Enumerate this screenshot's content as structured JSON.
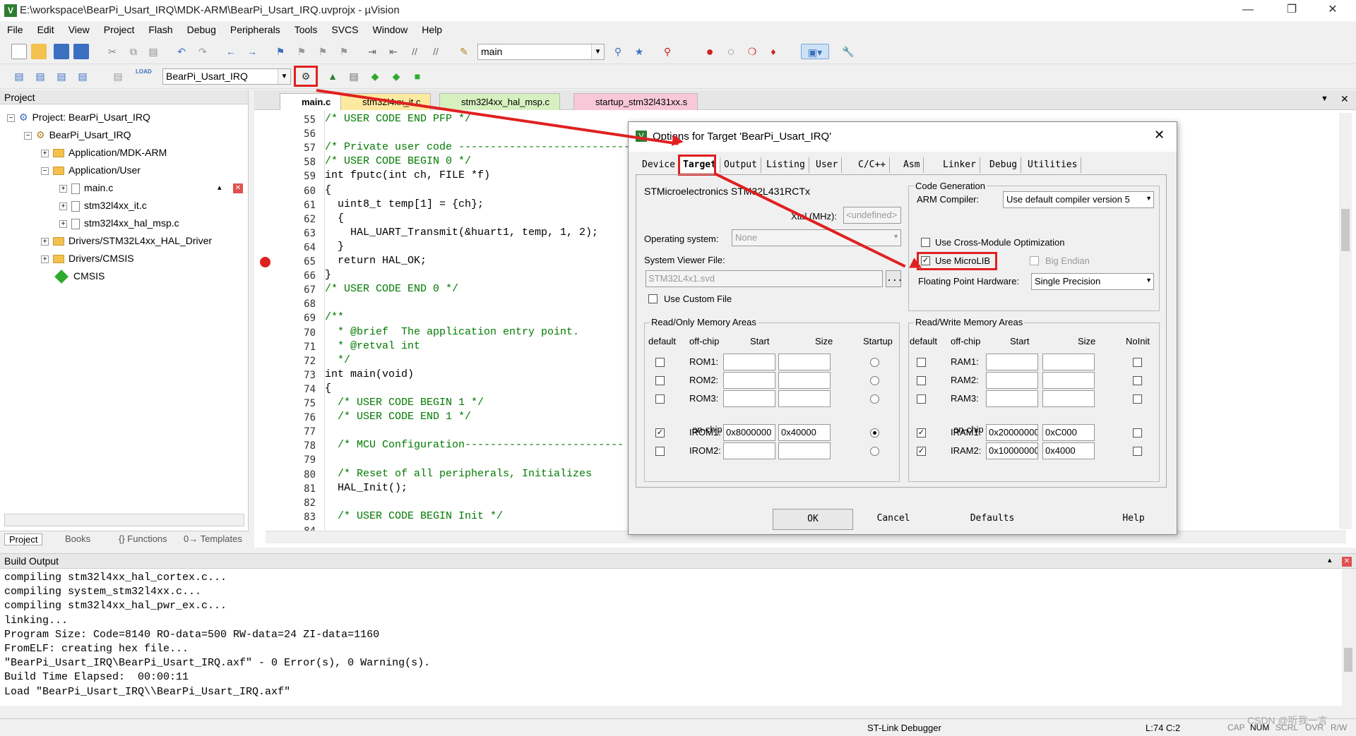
{
  "window": {
    "title": "E:\\workspace\\BearPi_Usart_IRQ\\MDK-ARM\\BearPi_Usart_IRQ.uvprojx - µVision"
  },
  "menu": [
    "File",
    "Edit",
    "View",
    "Project",
    "Flash",
    "Debug",
    "Peripherals",
    "Tools",
    "SVCS",
    "Window",
    "Help"
  ],
  "toolbar": {
    "find_combo": "main",
    "target_combo": "BearPi_Usart_IRQ",
    "load_label": "LOAD"
  },
  "project_panel": {
    "header": "Project",
    "tree": [
      {
        "label": "Project: BearPi_Usart_IRQ"
      },
      {
        "label": "BearPi_Usart_IRQ"
      },
      {
        "label": "Application/MDK-ARM"
      },
      {
        "label": "Application/User"
      },
      {
        "label": "main.c"
      },
      {
        "label": "stm32l4xx_it.c"
      },
      {
        "label": "stm32l4xx_hal_msp.c"
      },
      {
        "label": "Drivers/STM32L4xx_HAL_Driver"
      },
      {
        "label": "Drivers/CMSIS"
      },
      {
        "label": "CMSIS"
      }
    ],
    "tabs": [
      "Project",
      "Books",
      "{} Functions",
      "0→ Templates"
    ]
  },
  "editor": {
    "tabs": [
      "main.c",
      "stm32l4xx_it.c",
      "stm32l4xx_hal_msp.c",
      "startup_stm32l431xx.s"
    ],
    "lines": [
      {
        "n": "55",
        "t": "/* USER CODE END PFP */"
      },
      {
        "n": "56",
        "t": ""
      },
      {
        "n": "57",
        "t": "/* Private user code ---------------------------"
      },
      {
        "n": "58",
        "t": "/* USER CODE BEGIN 0 */"
      },
      {
        "n": "59",
        "t": "int fputc(int ch, FILE *f)"
      },
      {
        "n": "60",
        "t": "{"
      },
      {
        "n": "61",
        "t": "  uint8_t temp[1] = {ch};"
      },
      {
        "n": "62",
        "t": "  {"
      },
      {
        "n": "63",
        "t": "    HAL_UART_Transmit(&huart1, temp, 1, 2);"
      },
      {
        "n": "64",
        "t": "  }"
      },
      {
        "n": "65",
        "t": "  return HAL_OK;"
      },
      {
        "n": "66",
        "t": "}"
      },
      {
        "n": "67",
        "t": "/* USER CODE END 0 */"
      },
      {
        "n": "68",
        "t": ""
      },
      {
        "n": "69",
        "t": "/**"
      },
      {
        "n": "70",
        "t": "  * @brief  The application entry point."
      },
      {
        "n": "71",
        "t": "  * @retval int"
      },
      {
        "n": "72",
        "t": "  */"
      },
      {
        "n": "73",
        "t": "int main(void)"
      },
      {
        "n": "74",
        "t": "{"
      },
      {
        "n": "75",
        "t": "  /* USER CODE BEGIN 1 */"
      },
      {
        "n": "76",
        "t": "  /* USER CODE END 1 */"
      },
      {
        "n": "77",
        "t": ""
      },
      {
        "n": "78",
        "t": "  /* MCU Configuration-------------------------"
      },
      {
        "n": "79",
        "t": ""
      },
      {
        "n": "80",
        "t": "  /* Reset of all peripherals, Initializes"
      },
      {
        "n": "81",
        "t": "  HAL_Init();"
      },
      {
        "n": "82",
        "t": ""
      },
      {
        "n": "83",
        "t": "  /* USER CODE BEGIN Init */"
      },
      {
        "n": "84",
        "t": ""
      }
    ]
  },
  "dialog": {
    "title": "Options for Target 'BearPi_Usart_IRQ'",
    "tabs": [
      "Device",
      "Target",
      "Output",
      "Listing",
      "User",
      "C/C++",
      "Asm",
      "Linker",
      "Debug",
      "Utilities"
    ],
    "device": "STMicroelectronics STM32L431RCTx",
    "xtal_label": "Xtal (MHz):",
    "xtal_value": "<undefined>",
    "os_label": "Operating system:",
    "os_value": "None",
    "svf_label": "System Viewer File:",
    "svf_value": "STM32L4x1.svd",
    "use_custom_file": "Use Custom File",
    "code_gen_label": "Code Generation",
    "arm_compiler_label": "ARM Compiler:",
    "arm_compiler_value": "Use default compiler version 5",
    "cross_module": "Use Cross-Module Optimization",
    "use_microlib": "Use MicroLIB",
    "big_endian": "Big Endian",
    "fph_label": "Floating Point Hardware:",
    "fph_value": "Single Precision",
    "ro_group": "Read/Only Memory Areas",
    "rw_group": "Read/Write Memory Areas",
    "ro_headers": [
      "default",
      "off-chip",
      "Start",
      "Size",
      "Startup"
    ],
    "rw_headers": [
      "default",
      "off-chip",
      "Start",
      "Size",
      "NoInit"
    ],
    "on_chip": "on-chip",
    "rom": [
      {
        "name": "ROM1:",
        "start": "",
        "size": "",
        "default": false
      },
      {
        "name": "ROM2:",
        "start": "",
        "size": "",
        "default": false
      },
      {
        "name": "ROM3:",
        "start": "",
        "size": "",
        "default": false
      },
      {
        "name": "IROM1:",
        "start": "0x8000000",
        "size": "0x40000",
        "default": true
      },
      {
        "name": "IROM2:",
        "start": "",
        "size": "",
        "default": false
      }
    ],
    "ram": [
      {
        "name": "RAM1:",
        "start": "",
        "size": "",
        "default": false
      },
      {
        "name": "RAM2:",
        "start": "",
        "size": "",
        "default": false
      },
      {
        "name": "RAM3:",
        "start": "",
        "size": "",
        "default": false
      },
      {
        "name": "IRAM1:",
        "start": "0x20000000",
        "size": "0xC000",
        "default": true
      },
      {
        "name": "IRAM2:",
        "start": "0x10000000",
        "size": "0x4000",
        "default": true
      }
    ],
    "buttons": {
      "ok": "OK",
      "cancel": "Cancel",
      "defaults": "Defaults",
      "help": "Help"
    }
  },
  "build": {
    "header": "Build Output",
    "lines": [
      "compiling stm32l4xx_hal_cortex.c...",
      "compiling system_stm32l4xx.c...",
      "compiling stm32l4xx_hal_pwr_ex.c...",
      "linking...",
      "Program Size: Code=8140 RO-data=500 RW-data=24 ZI-data=1160",
      "FromELF: creating hex file...",
      "\"BearPi_Usart_IRQ\\BearPi_Usart_IRQ.axf\" - 0 Error(s), 0 Warning(s).",
      "Build Time Elapsed:  00:00:11",
      "Load \"BearPi_Usart_IRQ\\\\BearPi_Usart_IRQ.axf\""
    ]
  },
  "status": {
    "debugger": "ST-Link Debugger",
    "position": "L:74 C:2",
    "caps": "CAP",
    "num": "NUM",
    "scrl": "SCRL",
    "ovr": "OVR",
    "rw": "R/W",
    "watermark": "CSDN @听我一言"
  },
  "colors": {
    "highlight_red": "#e02020",
    "comment_green": "#007a00",
    "keyword_blue": "#0000d0"
  }
}
